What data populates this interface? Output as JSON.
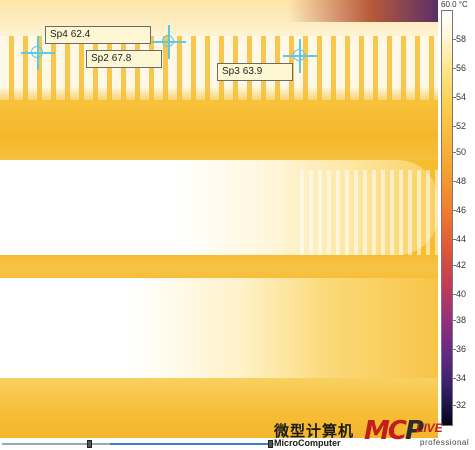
{
  "scale": {
    "title": "60.0 °C",
    "ticks": [
      "58",
      "56",
      "54",
      "52",
      "50",
      "48",
      "46",
      "44",
      "42",
      "40",
      "38",
      "36",
      "34",
      "32"
    ],
    "min_label": "",
    "colors": {
      "hot": "#ffffff",
      "warm": "#fbcb4a",
      "cool": "#c23c56",
      "cold": "#050318"
    }
  },
  "spots": [
    {
      "id": "Sp4",
      "value": "62.4"
    },
    {
      "id": "Sp2",
      "value": "67.8"
    },
    {
      "id": "Sp3",
      "value": "63.9"
    }
  ],
  "watermark": {
    "chinese": "微型计算机",
    "english": "MicroComputer",
    "logo_m": "M",
    "logo_c": "C",
    "logo_p": "P",
    "logo_live": "LIVE",
    "logo_pro": "professional"
  },
  "marker_color": "#5ec8e8",
  "accent": "#3b7fc7"
}
